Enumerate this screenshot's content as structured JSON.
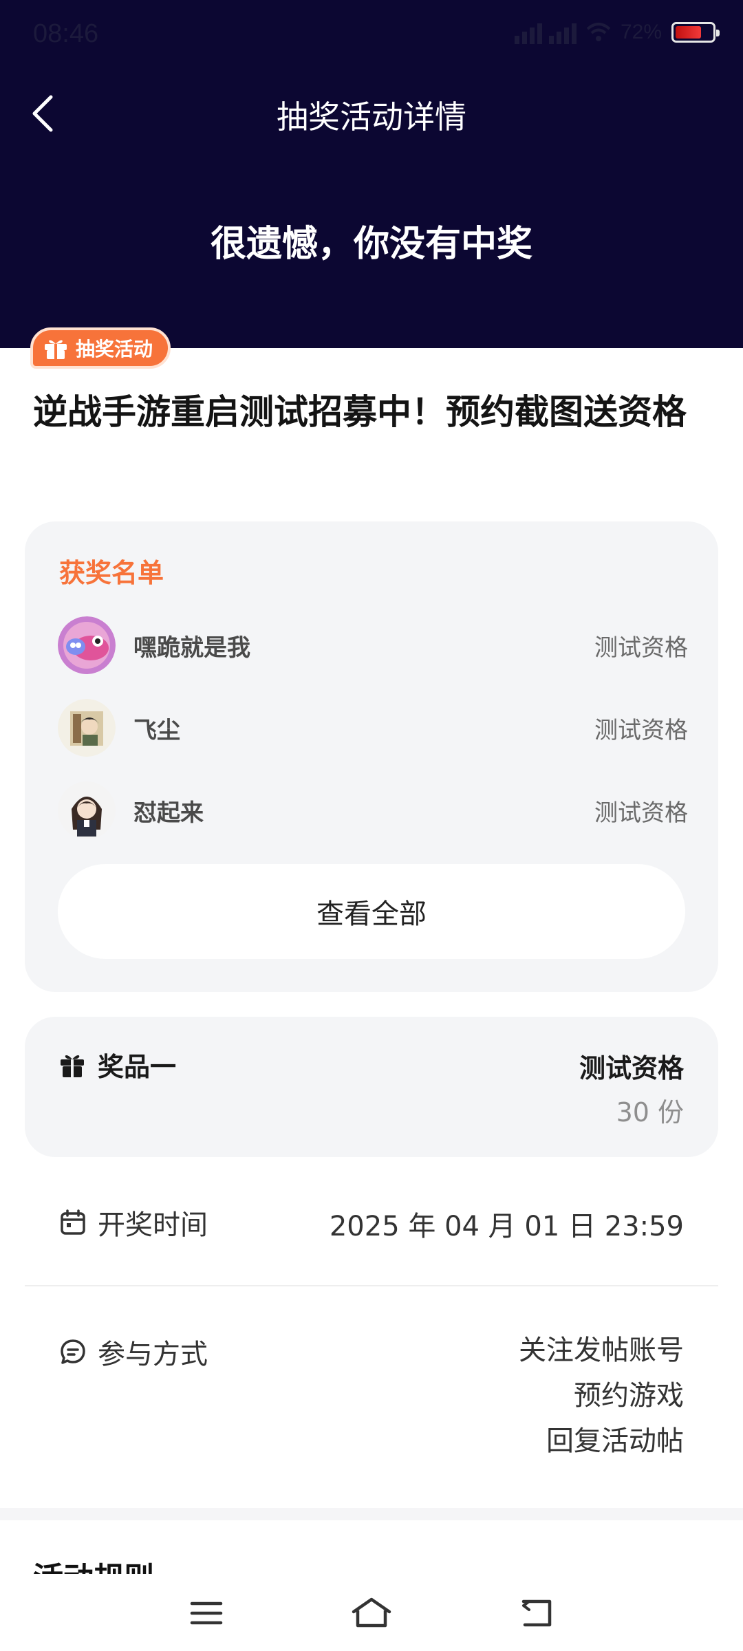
{
  "status": {
    "time": "08:46",
    "battery": "72%"
  },
  "header": {
    "title": "抽奖活动详情",
    "result": "很遗憾，你没有中奖"
  },
  "tag": {
    "label": "抽奖活动"
  },
  "post": {
    "title": "逆战手游重启测试招募中！预约截图送资格"
  },
  "winners": {
    "title": "获奖名单",
    "items": [
      {
        "name": "嘿跪就是我",
        "prize": "测试资格"
      },
      {
        "name": "飞尘",
        "prize": "测试资格"
      },
      {
        "name": "怼起来",
        "prize": "测试资格"
      }
    ],
    "view_all": "查看全部"
  },
  "prize": {
    "label": "奖品一",
    "name": "测试资格",
    "count": "30 份"
  },
  "draw_time": {
    "label": "开奖时间",
    "value": "2025 年 04 月 01 日 23:59"
  },
  "participation": {
    "label": "参与方式",
    "methods": [
      "关注发帖账号",
      "预约游戏",
      "回复活动帖"
    ]
  },
  "next_section": {
    "title": "活动规则"
  },
  "colors": {
    "header_bg": "#0c0732",
    "accent": "#f7733a",
    "card_bg": "#f4f5f7"
  }
}
